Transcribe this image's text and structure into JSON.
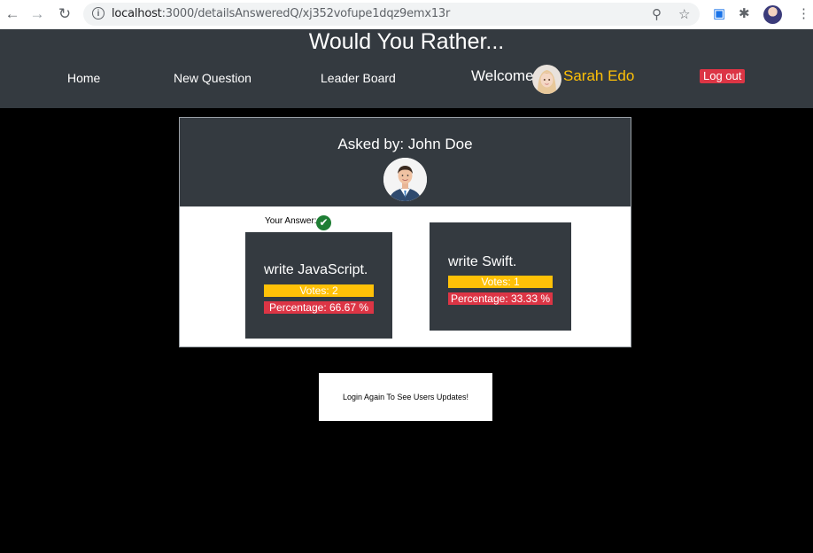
{
  "browser": {
    "url_host": "localhost",
    "url_rest": ":3000/detailsAnsweredQ/xj352vofupe1dqz9emx13r"
  },
  "app": {
    "title": "Would You Rather..."
  },
  "nav": {
    "home": "Home",
    "new_question": "New Question",
    "leader_board": "Leader Board",
    "welcome": "Welcome",
    "user_name": "Sarah Edo",
    "logout": "Log out"
  },
  "question": {
    "asked_by": "Asked by: John Doe",
    "your_answer_label": "Your Answer:",
    "options": [
      {
        "text": "write JavaScript.",
        "votes": "Votes: 2",
        "percentage": "Percentage: 66.67 %"
      },
      {
        "text": "write Swift.",
        "votes": "Votes: 1",
        "percentage": "Percentage: 33.33 %"
      }
    ]
  },
  "notice": {
    "text": "Login Again To See Users Updates!"
  },
  "colors": {
    "header_bg": "#343a40",
    "accent_yellow": "#ffc107",
    "danger_red": "#dc3545",
    "success_green": "#1e7e34"
  }
}
